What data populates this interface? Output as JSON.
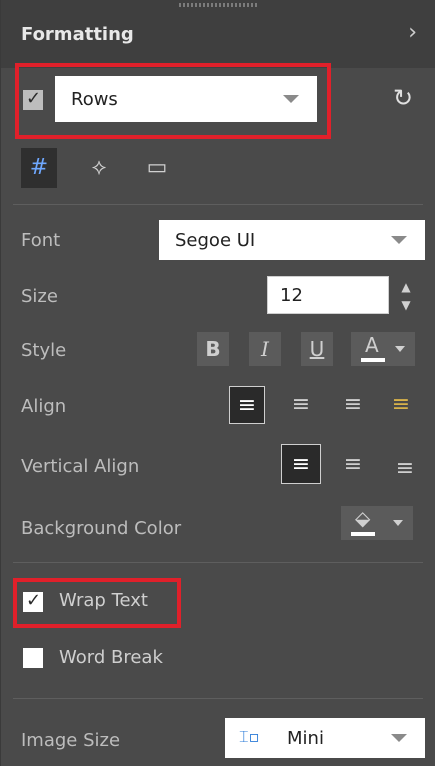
{
  "panel": {
    "title": "Formatting",
    "collapse_icon": "chevron-right-icon"
  },
  "target": {
    "checked": true,
    "select_value": "Rows",
    "reset_icon": "reset-icon"
  },
  "tabs": [
    {
      "name": "text-format-icon",
      "active": true
    },
    {
      "name": "paint-bucket-icon",
      "active": false
    },
    {
      "name": "border-icon",
      "active": false
    }
  ],
  "font": {
    "label": "Font",
    "value": "Segoe UI"
  },
  "size": {
    "label": "Size",
    "value": "12"
  },
  "style": {
    "label": "Style",
    "bold_label": "B",
    "italic_label": "I",
    "underline_label": "U",
    "font_color_letter": "A"
  },
  "align": {
    "label": "Align",
    "active_index": 0
  },
  "vertical_align": {
    "label": "Vertical Align",
    "active_index": 0
  },
  "background_color": {
    "label": "Background Color"
  },
  "options": {
    "wrap_text_label": "Wrap Text",
    "wrap_text_checked": true,
    "word_break_label": "Word Break",
    "word_break_checked": false
  },
  "image_size": {
    "label": "Image Size",
    "value": "Mini"
  },
  "colors": {
    "accent": "#e0202a",
    "panel_bg": "#4a4a4a",
    "header_bg": "#3f3f3f",
    "active_tab_icon": "#6fa8ff"
  }
}
